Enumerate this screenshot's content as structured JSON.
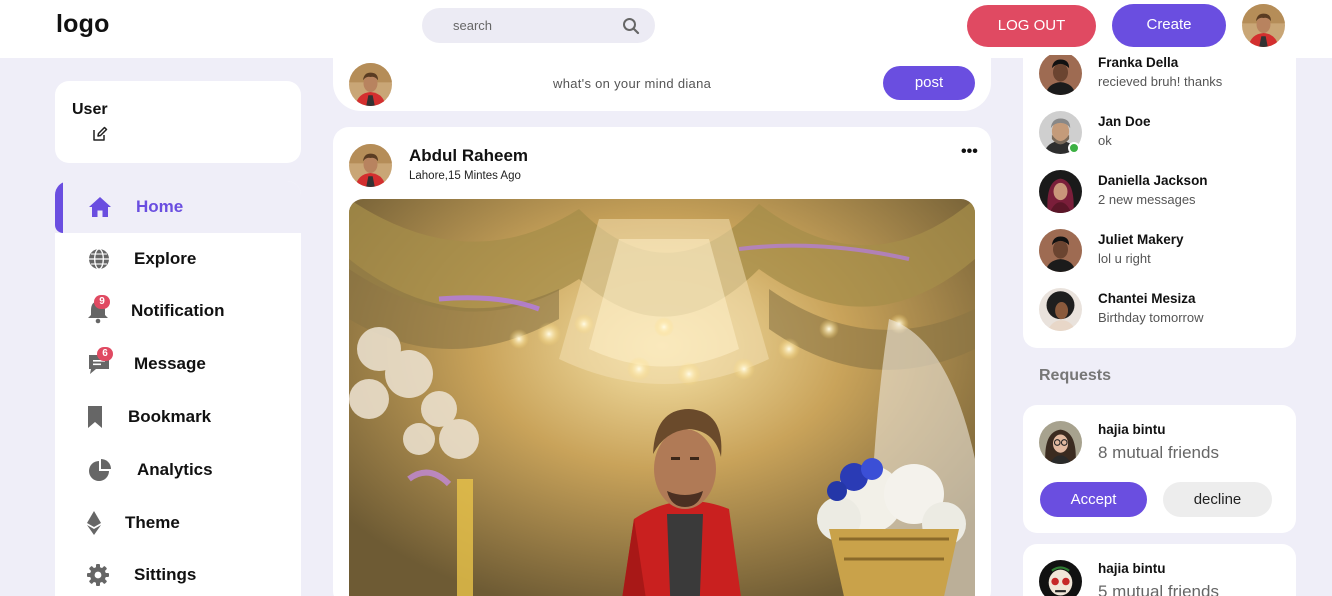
{
  "nav": {
    "logo": "logo",
    "search_placeholder": "search",
    "logout_label": "LOG OUT",
    "create_label": "Create",
    "icons": {
      "search": "search-icon"
    }
  },
  "colors": {
    "accent": "#6a4ee0",
    "danger": "#e04a62",
    "background": "#efeef8",
    "online": "#3cb043"
  },
  "user_card": {
    "title": "User",
    "icon": "edit-icon"
  },
  "sidebar": {
    "items": [
      {
        "label": "Home",
        "icon": "home-icon",
        "active": true
      },
      {
        "label": "Explore",
        "icon": "globe-icon"
      },
      {
        "label": "Notification",
        "icon": "bell-icon",
        "badge": "9"
      },
      {
        "label": "Message",
        "icon": "chat-icon",
        "badge": "6"
      },
      {
        "label": "Bookmark",
        "icon": "bookmark-icon"
      },
      {
        "label": "Analytics",
        "icon": "pie-chart-icon"
      },
      {
        "label": "Theme",
        "icon": "ethereum-icon"
      },
      {
        "label": "Sittings",
        "icon": "gear-icon"
      }
    ]
  },
  "composer": {
    "prompt": "what's on your mind diana",
    "post_label": "post"
  },
  "feed": {
    "posts": [
      {
        "author": "Abdul Raheem",
        "meta": "Lahore,15 Mintes Ago",
        "more": "•••"
      }
    ]
  },
  "messages": [
    {
      "name": "Franka Della",
      "text": "recieved bruh! thanks"
    },
    {
      "name": "Jan Doe",
      "text": "ok",
      "online": true
    },
    {
      "name": "Daniella Jackson",
      "text": "2 new messages"
    },
    {
      "name": "Juliet Makery",
      "text": "lol u right"
    },
    {
      "name": "Chantei Mesiza",
      "text": "Birthday tomorrow"
    }
  ],
  "requests": {
    "heading": "Requests",
    "items": [
      {
        "name": "hajia bintu",
        "mutual": "8 mutual friends",
        "accept_label": "Accept",
        "decline_label": "decline"
      },
      {
        "name": "hajia bintu",
        "mutual": "5 mutual friends"
      }
    ]
  }
}
